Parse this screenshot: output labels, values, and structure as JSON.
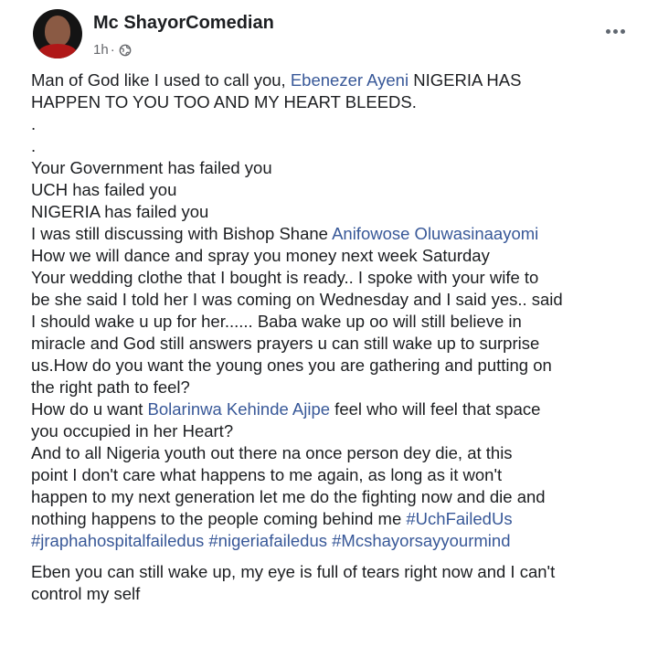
{
  "post": {
    "author": "Mc ShayorComedian",
    "time": "1h",
    "separator": "·",
    "privacy_icon": "globe-icon",
    "more_icon": "more-options-icon",
    "colors": {
      "text": "#1c1e21",
      "link": "#385898",
      "meta": "#65676b"
    },
    "p1": {
      "a": "Man of God like I used to call you, ",
      "mention": "Ebenezer Ayeni",
      "b": " NIGERIA HAS",
      "c": "HAPPEN TO YOU TOO AND MY HEART BLEEDS."
    },
    "dot1": ".",
    "dot2": ".",
    "lines": {
      "l1": "Your Government has failed you",
      "l2": "UCH has failed you",
      "l3": "NIGERIA has failed you",
      "l4a": "I was still discussing with Bishop Shane ",
      "l4mention": "Anifowose Oluwasinaayomi",
      "l5": "How we will dance and spray you money next week Saturday",
      "l6": "Your wedding clothe that I bought is ready.. I spoke with your wife to",
      "l7": "be she said I told her I was coming on Wednesday and I said yes.. said",
      "l8": "I should wake u up for her...... Baba wake up oo will still believe in",
      "l9": "miracle and God still answers prayers u can still wake up to surprise",
      "l10": "us.How do you want the young ones you are gathering and putting on",
      "l11": "the right path to feel?",
      "l12a": "How do u want ",
      "l12mention": "Bolarinwa Kehinde Ajipe",
      "l12b": " feel who will feel that space",
      "l13": "you occupied in her Heart?",
      "l14": "And to all Nigeria youth out there na once person dey die, at this",
      "l15": "point I don't care what happens to me again, as long as it won't",
      "l16": "happen to my next generation let me do the fighting now and die and",
      "l17a": "nothing happens to the people coming behind me ",
      "h1": "#UchFailedUs",
      "h2": "#jraphahospitalfailedus",
      "h3": "#nigeriafailedus",
      "h4": "#Mcshayorsayyourmind"
    },
    "p3": {
      "l1": "Eben you can still wake up, my eye is full of tears right now and I can't",
      "l2": "control my self"
    }
  }
}
